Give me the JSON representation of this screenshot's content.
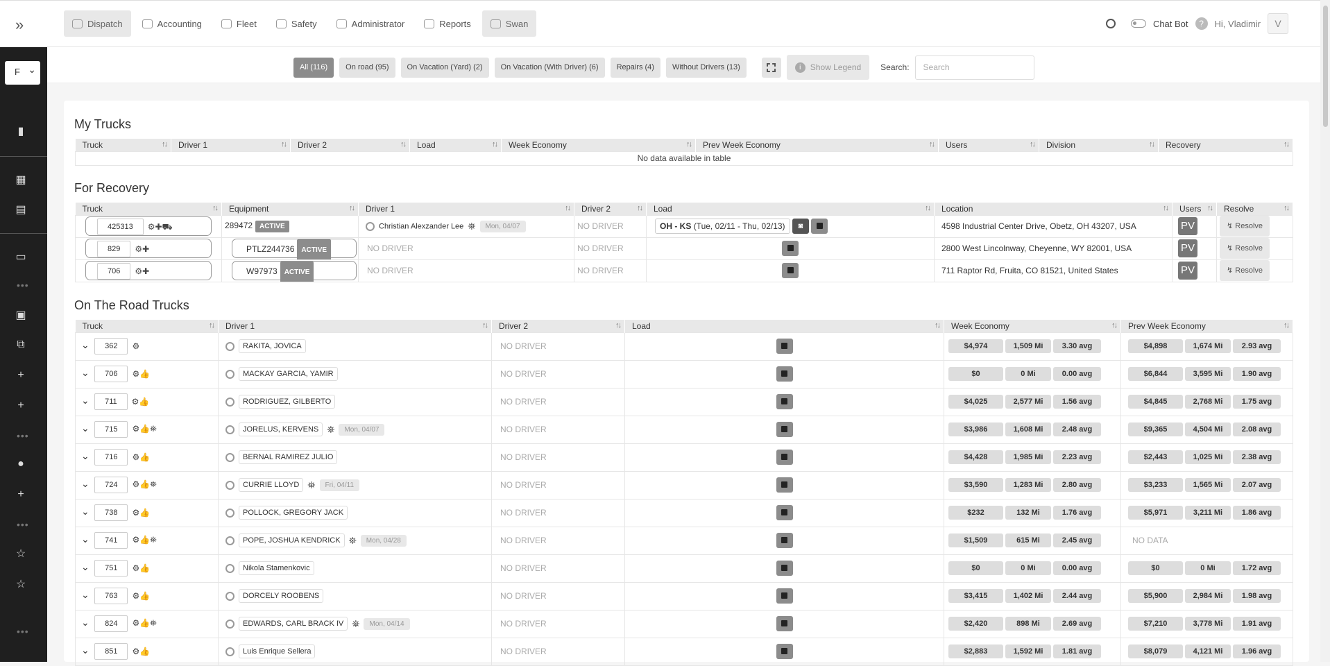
{
  "nav": {
    "tabs": [
      "Dispatch",
      "Accounting",
      "Fleet",
      "Safety",
      "Administrator",
      "Reports",
      "Swan"
    ],
    "chat_bot": "Chat Bot",
    "help": "?",
    "greeting": "Hi, Vladimir",
    "avatar": "V"
  },
  "sidebar": {
    "select_value": "F"
  },
  "filters": {
    "buttons": [
      "All (116)",
      "On road (95)",
      "On Vacation (Yard) (2)",
      "On Vacation (With Driver) (6)",
      "Repairs (4)",
      "Without Drivers (13)"
    ],
    "legend": "Show Legend",
    "search_label": "Search:",
    "search_placeholder": "Search"
  },
  "my_trucks": {
    "title": "My Trucks",
    "headers": [
      "Truck",
      "Driver 1",
      "Driver 2",
      "Load",
      "Week Economy",
      "Prev Week Economy",
      "Users",
      "Division",
      "Recovery"
    ],
    "empty": "No data available in table"
  },
  "recovery": {
    "title": "For Recovery",
    "headers": [
      "Truck",
      "Equipment",
      "Driver 1",
      "Driver 2",
      "Load",
      "Location",
      "Users",
      "Resolve"
    ],
    "rows": [
      {
        "truck": "425313",
        "equipment": "289472",
        "status": "ACTIVE",
        "driver1": "Christian Alexzander Lee",
        "date": "Mon, 04/07",
        "driver2": "NO DRIVER",
        "load_route": "OH - KS",
        "load_dates": "(Tue, 02/11 - Thu, 02/13)",
        "location": "4598 Industrial Center Drive, Obetz, OH 43207, USA",
        "users": "PV",
        "resolve": "Resolve"
      },
      {
        "truck": "829",
        "equipment": "PTLZ244736",
        "status": "ACTIVE",
        "driver1": "NO DRIVER",
        "date": "",
        "driver2": "NO DRIVER",
        "load_route": "",
        "load_dates": "",
        "location": "2800 West Lincolnway, Cheyenne, WY 82001, USA",
        "users": "PV",
        "resolve": "Resolve"
      },
      {
        "truck": "706",
        "equipment": "W97973",
        "status": "ACTIVE",
        "driver1": "NO DRIVER",
        "date": "",
        "driver2": "NO DRIVER",
        "load_route": "",
        "load_dates": "",
        "location": "711 Raptor Rd, Fruita, CO 81521, United States",
        "users": "PV",
        "resolve": "Resolve"
      }
    ]
  },
  "road": {
    "title": "On The Road Trucks",
    "headers": [
      "Truck",
      "Driver 1",
      "Driver 2",
      "Load",
      "Week Economy",
      "Prev Week Economy"
    ],
    "rows": [
      {
        "truck": "362",
        "driver": "RAKITA, JOVICA",
        "date": "",
        "driver2": "NO DRIVER",
        "week": [
          "$4,974",
          "1,509 Mi",
          "3.30 avg"
        ],
        "prev": [
          "$4,898",
          "1,674 Mi",
          "2.93 avg"
        ]
      },
      {
        "truck": "706",
        "driver": "MACKAY GARCIA, YAMIR",
        "date": "",
        "driver2": "NO DRIVER",
        "week": [
          "$0",
          "0 Mi",
          "0.00 avg"
        ],
        "prev": [
          "$6,844",
          "3,595 Mi",
          "1.90 avg"
        ]
      },
      {
        "truck": "711",
        "driver": "RODRIGUEZ, GILBERTO",
        "date": "",
        "driver2": "NO DRIVER",
        "week": [
          "$4,025",
          "2,577 Mi",
          "1.56 avg"
        ],
        "prev": [
          "$4,845",
          "2,768 Mi",
          "1.75 avg"
        ]
      },
      {
        "truck": "715",
        "driver": "JORELUS, KERVENS",
        "date": "Mon, 04/07",
        "driver2": "NO DRIVER",
        "week": [
          "$3,986",
          "1,608 Mi",
          "2.48 avg"
        ],
        "prev": [
          "$9,365",
          "4,504 Mi",
          "2.08 avg"
        ]
      },
      {
        "truck": "716",
        "driver": "BERNAL RAMIREZ JULIO",
        "date": "",
        "driver2": "NO DRIVER",
        "week": [
          "$4,428",
          "1,985 Mi",
          "2.23 avg"
        ],
        "prev": [
          "$2,443",
          "1,025 Mi",
          "2.38 avg"
        ]
      },
      {
        "truck": "724",
        "driver": "CURRIE LLOYD",
        "date": "Fri, 04/11",
        "driver2": "NO DRIVER",
        "week": [
          "$3,590",
          "1,283 Mi",
          "2.80 avg"
        ],
        "prev": [
          "$3,233",
          "1,565 Mi",
          "2.07 avg"
        ]
      },
      {
        "truck": "738",
        "driver": "POLLOCK, GREGORY JACK",
        "date": "",
        "driver2": "NO DRIVER",
        "week": [
          "$232",
          "132 Mi",
          "1.76 avg"
        ],
        "prev": [
          "$5,971",
          "3,211 Mi",
          "1.86 avg"
        ]
      },
      {
        "truck": "741",
        "driver": "POPE, JOSHUA KENDRICK",
        "date": "Mon, 04/28",
        "driver2": "NO DRIVER",
        "week": [
          "$1,509",
          "615 Mi",
          "2.45 avg"
        ],
        "prev": [],
        "prev_text": "NO DATA"
      },
      {
        "truck": "751",
        "driver": "Nikola Stamenkovic",
        "date": "",
        "driver2": "NO DRIVER",
        "week": [
          "$0",
          "0 Mi",
          "0.00 avg"
        ],
        "prev": [
          "$0",
          "0 Mi",
          "1.72 avg"
        ]
      },
      {
        "truck": "763",
        "driver": "DORCELY ROOBENS",
        "date": "",
        "driver2": "NO DRIVER",
        "week": [
          "$3,415",
          "1,402 Mi",
          "2.44 avg"
        ],
        "prev": [
          "$5,900",
          "2,984 Mi",
          "1.98 avg"
        ]
      },
      {
        "truck": "824",
        "driver": "EDWARDS, CARL BRACK IV",
        "date": "Mon, 04/14",
        "driver2": "NO DRIVER",
        "week": [
          "$2,420",
          "898 Mi",
          "2.69 avg"
        ],
        "prev": [
          "$7,210",
          "3,778 Mi",
          "1.91 avg"
        ]
      },
      {
        "truck": "851",
        "driver": "Luis Enrique Sellera",
        "date": "",
        "driver2": "NO DRIVER",
        "week": [
          "$2,883",
          "1,592 Mi",
          "1.81 avg"
        ],
        "prev": [
          "$8,079",
          "4,121 Mi",
          "1.96 avg"
        ]
      }
    ]
  }
}
